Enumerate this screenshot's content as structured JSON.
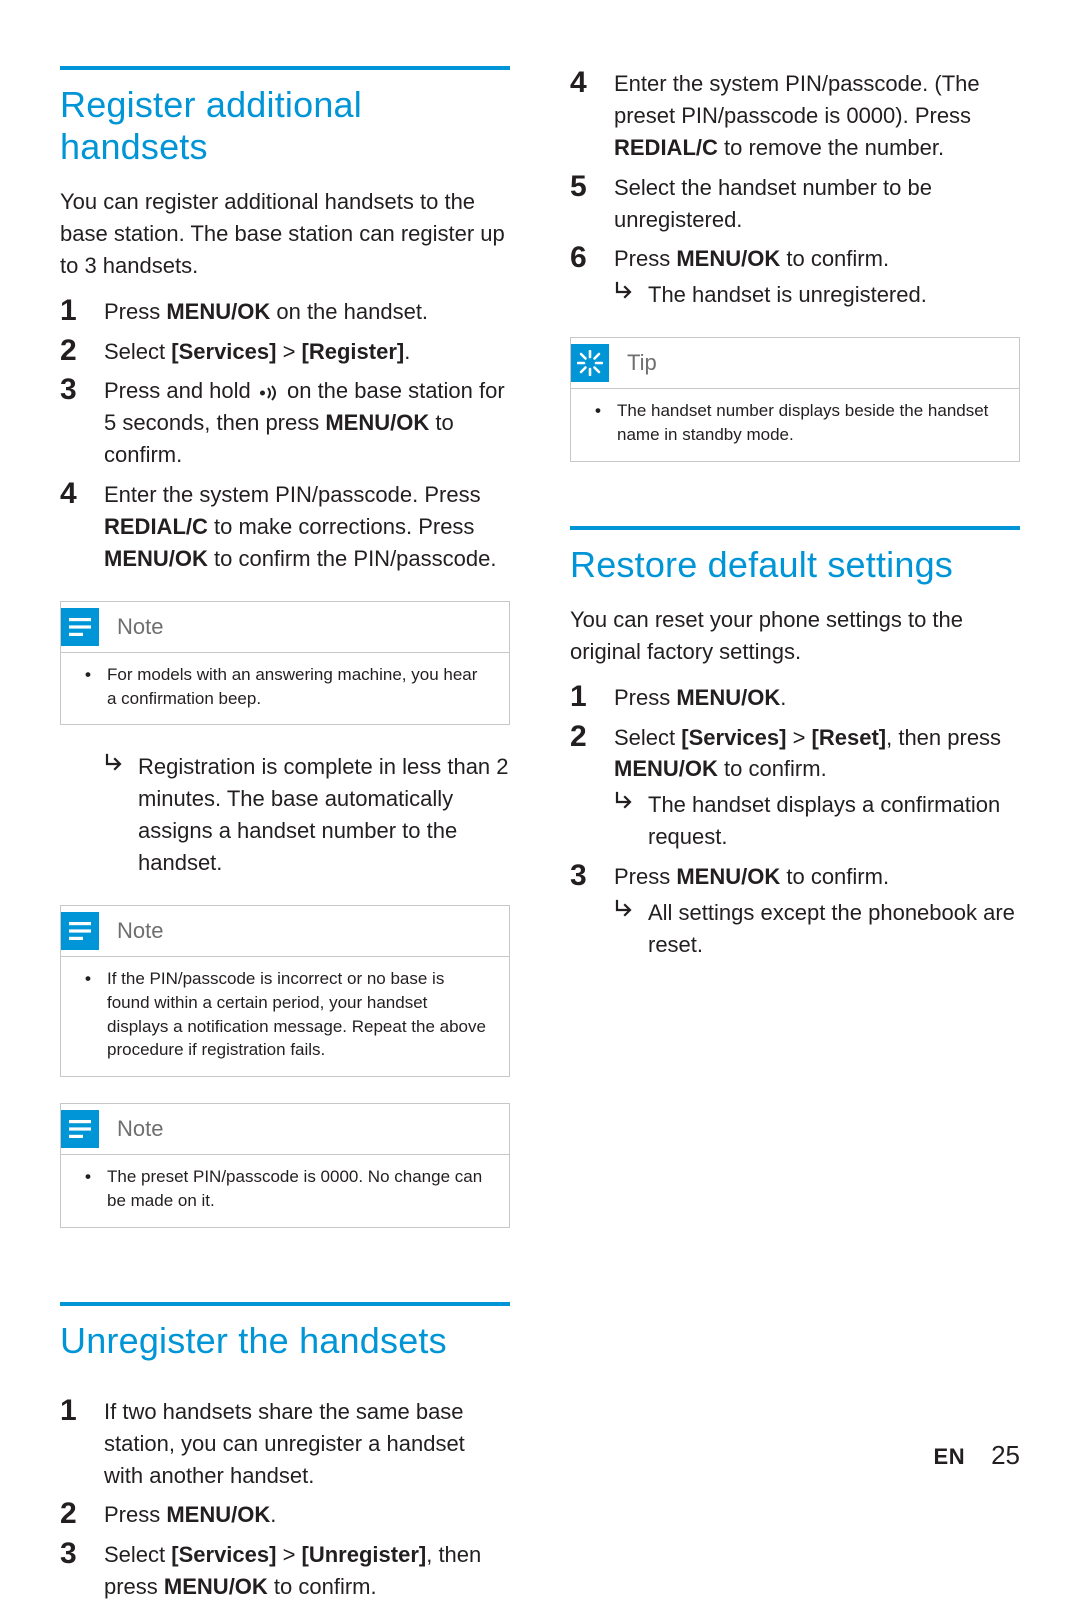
{
  "left": {
    "sectionA": {
      "title": "Register additional handsets",
      "intro": "You can register additional handsets to the base station. The base station can register up to 3 handsets.",
      "steps": [
        {
          "num": "1",
          "html": "Press <strong>MENU/OK</strong> on the handset."
        },
        {
          "num": "2",
          "html": "Select <strong>[Services]</strong> > <strong>[Register]</strong>."
        },
        {
          "num": "3",
          "html": "Press and hold <span class=\"signal-icon\" data-name=\"signal-icon\" data-interactable=\"false\"><svg width=\"20\" height=\"16\" viewBox=\"0 0 20 16\"><circle cx=\"3.5\" cy=\"8\" r=\"2.5\" fill=\"#231f20\"/><path d=\"M9 3 Q13 8 9 13\" stroke=\"#231f20\" stroke-width=\"2\" fill=\"none\"/><path d=\"M13 1 Q19 8 13 15\" stroke=\"#231f20\" stroke-width=\"2\" fill=\"none\"/></svg></span> on the base station for 5 seconds, then press <strong>MENU/OK</strong> to confirm."
        },
        {
          "num": "4",
          "html": "Enter the system PIN/passcode. Press <strong>REDIAL/C</strong> to make corrections. Press <strong>MENU/OK</strong> to confirm the PIN/passcode."
        }
      ],
      "note1": {
        "title": "Note",
        "body": "For models with an answering machine, you hear a confirmation beep."
      },
      "result": "Registration is complete in less than 2 minutes. The base automatically assigns a handset number to the handset.",
      "note2": {
        "title": "Note",
        "body": "If the PIN/passcode is incorrect or no base is found within a certain period, your handset displays a notification message. Repeat the above procedure if registration fails."
      },
      "note3": {
        "title": "Note",
        "body": "The preset PIN/passcode is 0000. No change can be made on it."
      }
    },
    "sectionB": {
      "title": "Unregister the handsets",
      "steps": [
        {
          "num": "1",
          "html": "If two handsets share the same base station, you can unregister a handset with another handset."
        },
        {
          "num": "2",
          "html": "Press <strong>MENU/OK</strong>."
        },
        {
          "num": "3",
          "html": "Select <strong>[Services]</strong> > <strong>[Unregister]</strong>, then press <strong>MENU/OK</strong> to confirm."
        }
      ]
    }
  },
  "right": {
    "continuedSteps": [
      {
        "num": "4",
        "html": "Enter the system PIN/passcode. (The preset PIN/passcode is 0000). Press <strong>REDIAL/C</strong> to remove the number."
      },
      {
        "num": "5",
        "html": "Select the handset number to be unregistered."
      },
      {
        "num": "6",
        "html": "Press <strong>MENU/OK</strong> to confirm.",
        "result": "The handset is unregistered."
      }
    ],
    "tip": {
      "title": "Tip",
      "body": "The handset number displays beside the handset name in standby mode."
    },
    "sectionC": {
      "title": "Restore default settings",
      "intro": "You can reset your phone settings to the original factory settings.",
      "steps": [
        {
          "num": "1",
          "html": "Press <strong>MENU/OK</strong>."
        },
        {
          "num": "2",
          "html": "Select <strong>[Services]</strong> > <strong>[Reset]</strong>, then press <strong>MENU/OK</strong> to confirm.",
          "result": "The handset displays a confirmation request."
        },
        {
          "num": "3",
          "html": "Press <strong>MENU/OK</strong> to confirm.",
          "result": "All settings except the phonebook are reset."
        }
      ]
    }
  },
  "footer": {
    "lang": "EN",
    "page": "25"
  }
}
